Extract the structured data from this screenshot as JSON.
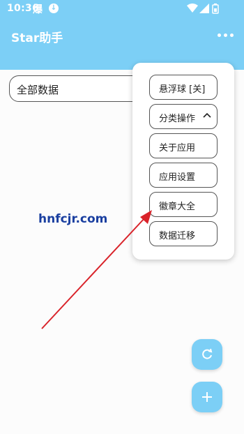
{
  "status_bar": {
    "time": "10:36",
    "app_badge": "爆"
  },
  "header": {
    "title": "Star助手"
  },
  "filter": {
    "label": "全部数据"
  },
  "watermark": "hnfcjr.com",
  "menu": {
    "items": [
      {
        "label": "悬浮球 [关]"
      },
      {
        "label": "分类操作"
      },
      {
        "label": "关于应用"
      },
      {
        "label": "应用设置"
      },
      {
        "label": "徽章大全"
      },
      {
        "label": "数据迁移"
      }
    ]
  },
  "colors": {
    "accent": "#7ccff6",
    "annotation_arrow": "#d9232a",
    "watermark": "#1a3fa0"
  }
}
